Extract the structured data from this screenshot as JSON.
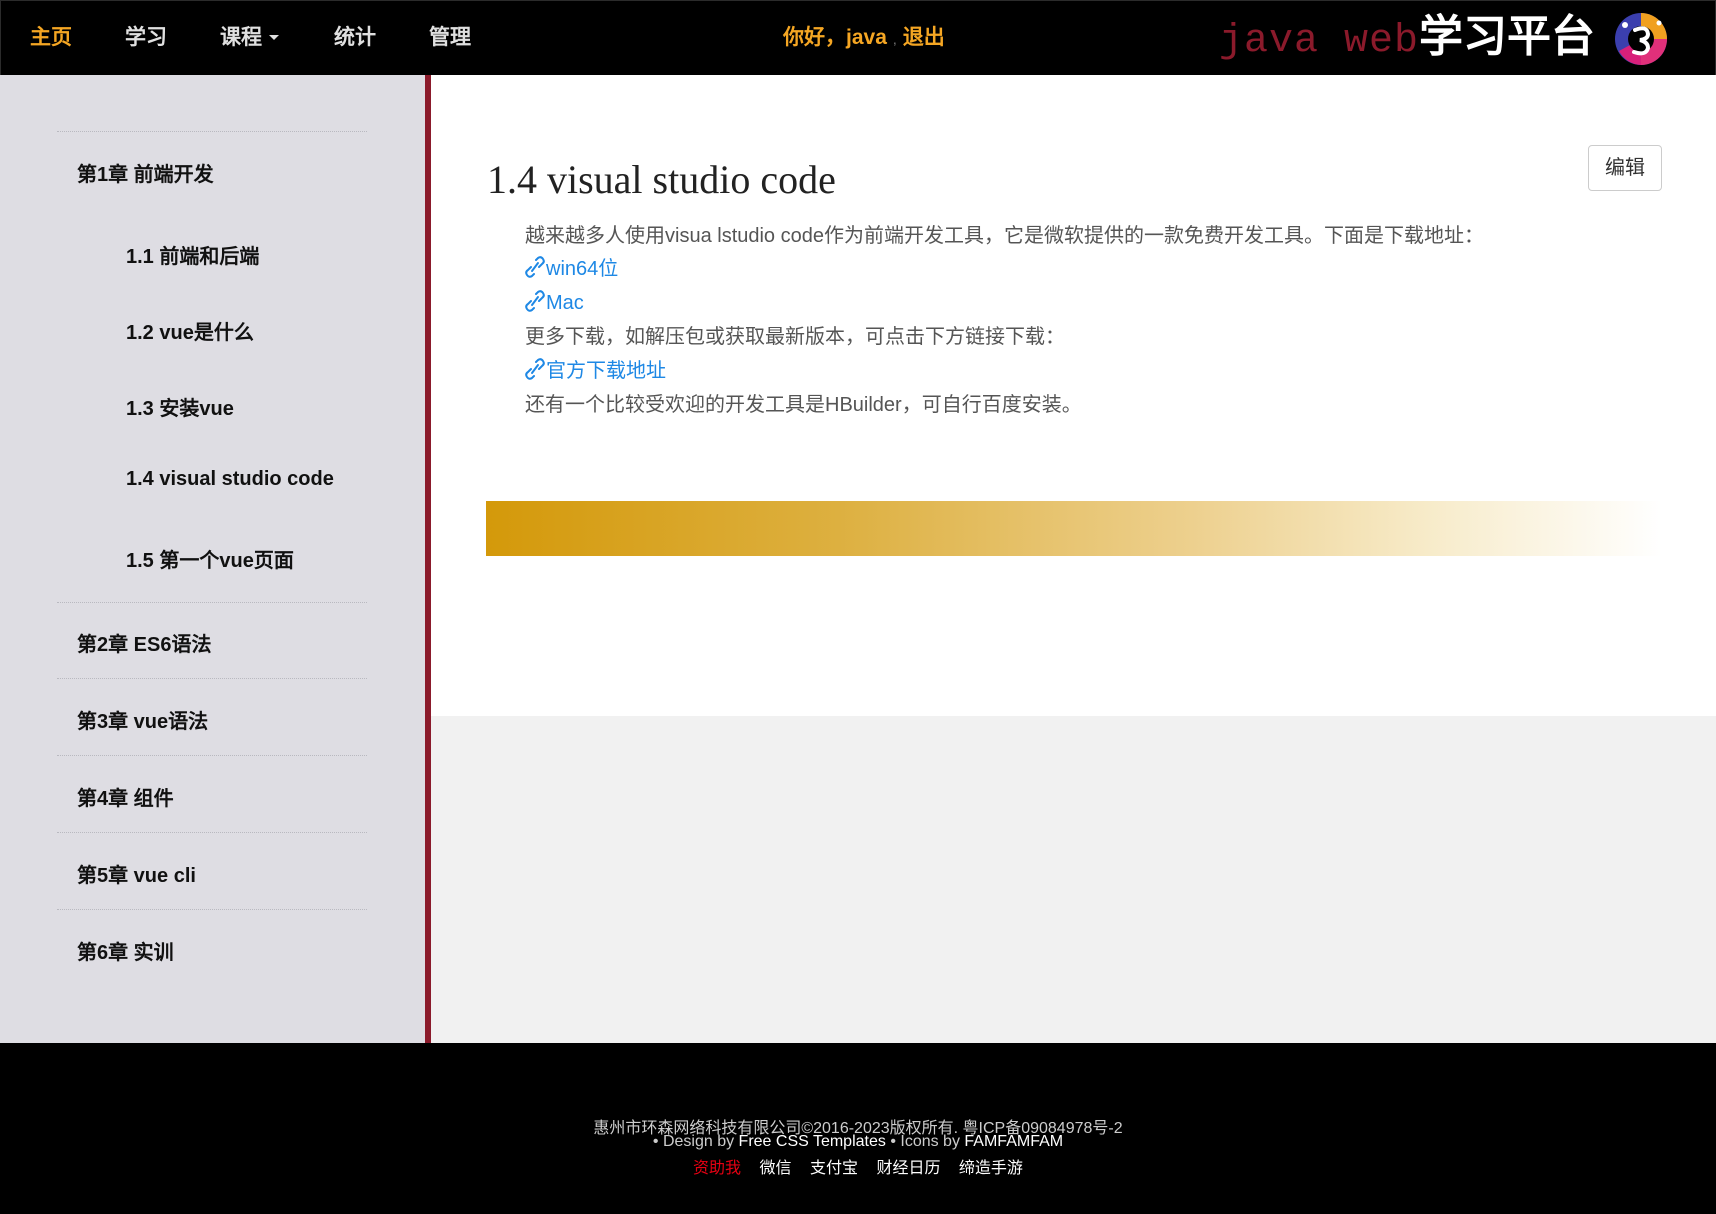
{
  "nav": {
    "items": [
      {
        "label": "主页",
        "active": true
      },
      {
        "label": "学习"
      },
      {
        "label": "课程",
        "dropdown": true
      },
      {
        "label": "统计"
      },
      {
        "label": "管理"
      }
    ],
    "greeting": "你好，java",
    "separator": ",",
    "logout": "退出",
    "brand_en": "java web",
    "brand_cn": "学习平台"
  },
  "sidebar": {
    "chapters": [
      {
        "title": "第1章 前端开发",
        "sections": [
          "1.1 前端和后端",
          "1.2 vue是什么",
          "1.3 安装vue",
          "1.4 visual studio code",
          "1.5 第一个vue页面"
        ]
      },
      {
        "title": "第2章 ES6语法"
      },
      {
        "title": "第3章 vue语法"
      },
      {
        "title": "第4章 组件"
      },
      {
        "title": "第5章 vue cli"
      },
      {
        "title": "第6章 实训"
      }
    ]
  },
  "main": {
    "title": "1.4 visual studio code",
    "edit_label": "编辑",
    "intro": "越来越多人使用visua lstudio code作为前端开发工具，它是微软提供的一款免费开发工具。下面是下载地址：",
    "link_win": "win64位",
    "link_mac": "Mac",
    "more": "更多下载，如解压包或获取最新版本，可点击下方链接下载：",
    "link_official": "官方下载地址",
    "tail": "还有一个比较受欢迎的开发工具是HBuilder，可自行百度安装。"
  },
  "footer": {
    "copyright": "惠州市环森网络科技有限公司©2016-2023版权所有. 粤ICP备09084978号-2",
    "bullet1": "• Design by ",
    "design": "Free CSS Templates",
    "bullet2": " • Icons by ",
    "icons": "FAMFAMFAM",
    "links": [
      "资助我",
      "微信",
      "支付宝",
      "财经日历",
      "缔造手游"
    ]
  },
  "colors": {
    "accent": "#f5a623",
    "sidebar_border": "#8b1a2b",
    "link": "#1e88e5",
    "donate": "#e60012"
  }
}
